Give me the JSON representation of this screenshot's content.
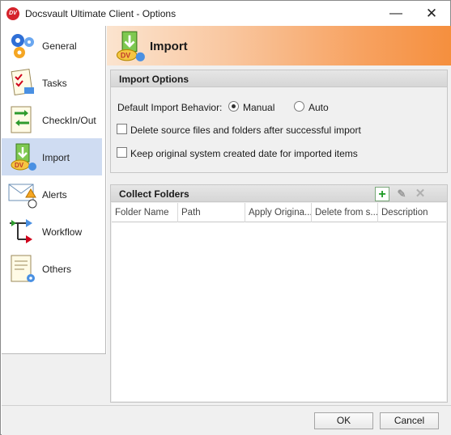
{
  "window": {
    "title": "Docsvault Ultimate Client - Options",
    "app_icon": "docsvault-logo-icon",
    "app_icon_text": "DV",
    "minimize_glyph": "—",
    "close_glyph": "✕"
  },
  "sidebar": {
    "items": [
      {
        "label": "General",
        "icon": "gears-icon"
      },
      {
        "label": "Tasks",
        "icon": "task-checklist-icon"
      },
      {
        "label": "CheckIn/Out",
        "icon": "document-arrows-icon"
      },
      {
        "label": "Import",
        "icon": "import-icon"
      },
      {
        "label": "Alerts",
        "icon": "envelope-alert-icon"
      },
      {
        "label": "Workflow",
        "icon": "workflow-arrows-icon"
      },
      {
        "label": "Others",
        "icon": "document-gear-icon"
      }
    ],
    "selected": "Import"
  },
  "header": {
    "title": "Import",
    "icon": "import-icon"
  },
  "import_options": {
    "title": "Import Options",
    "behavior_label": "Default Import Behavior:",
    "radio_manual": "Manual",
    "radio_auto": "Auto",
    "selected_behavior": "Manual",
    "delete_source_label": "Delete source files and folders after successful import",
    "delete_source_checked": false,
    "keep_date_label": "Keep original system created date for imported items",
    "keep_date_checked": false
  },
  "collect_folders": {
    "title": "Collect Folders",
    "add_glyph": "+",
    "edit_glyph": "✎",
    "delete_glyph": "✕",
    "columns": [
      "Folder Name",
      "Path",
      "Apply Origina...",
      "Delete from s...",
      "Description"
    ],
    "rows": []
  },
  "footer": {
    "ok_label": "OK",
    "cancel_label": "Cancel"
  },
  "colors": {
    "selected_nav": "#cfdcf2",
    "header_gradient_end": "#f58f3e",
    "add_green": "#1b9a22"
  }
}
